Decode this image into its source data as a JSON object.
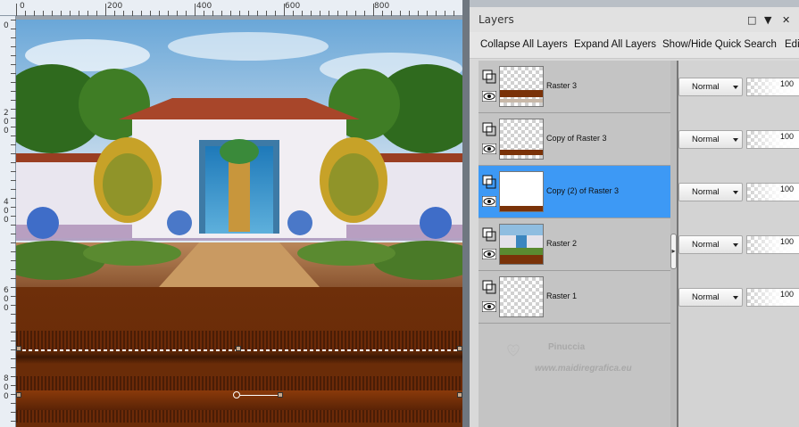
{
  "ruler": {
    "top_labels": [
      "0",
      "200",
      "400",
      "600",
      "800"
    ],
    "left_labels": [
      "0",
      "2",
      "0",
      "0",
      "4",
      "0",
      "0",
      "6",
      "0",
      "0",
      "8",
      "0",
      "0"
    ]
  },
  "panel": {
    "title": "Layers",
    "header_icons": [
      "maximize-icon",
      "pin-icon",
      "close-icon"
    ],
    "toolbar": {
      "collapse": "Collapse All Layers",
      "expand": "Expand All Layers",
      "quick_search": "Show/Hide Quick Search",
      "edit": "Edi"
    }
  },
  "layers": [
    {
      "name": "Raster 3",
      "blend": "Normal",
      "opacity": "100",
      "selected": false
    },
    {
      "name": "Copy of Raster 3",
      "blend": "Normal",
      "opacity": "100",
      "selected": false
    },
    {
      "name": "Copy (2) of Raster 3",
      "blend": "Normal",
      "opacity": "100",
      "selected": true
    },
    {
      "name": "Raster 2",
      "blend": "Normal",
      "opacity": "100",
      "selected": false
    },
    {
      "name": "Raster 1",
      "blend": "Normal",
      "opacity": "100",
      "selected": false
    }
  ],
  "watermark": {
    "brand": "Pinuccia",
    "url": "www.maidiregrafica.eu"
  },
  "colors": {
    "selection": "#3d99f5",
    "brown": "#6b2c0b"
  }
}
